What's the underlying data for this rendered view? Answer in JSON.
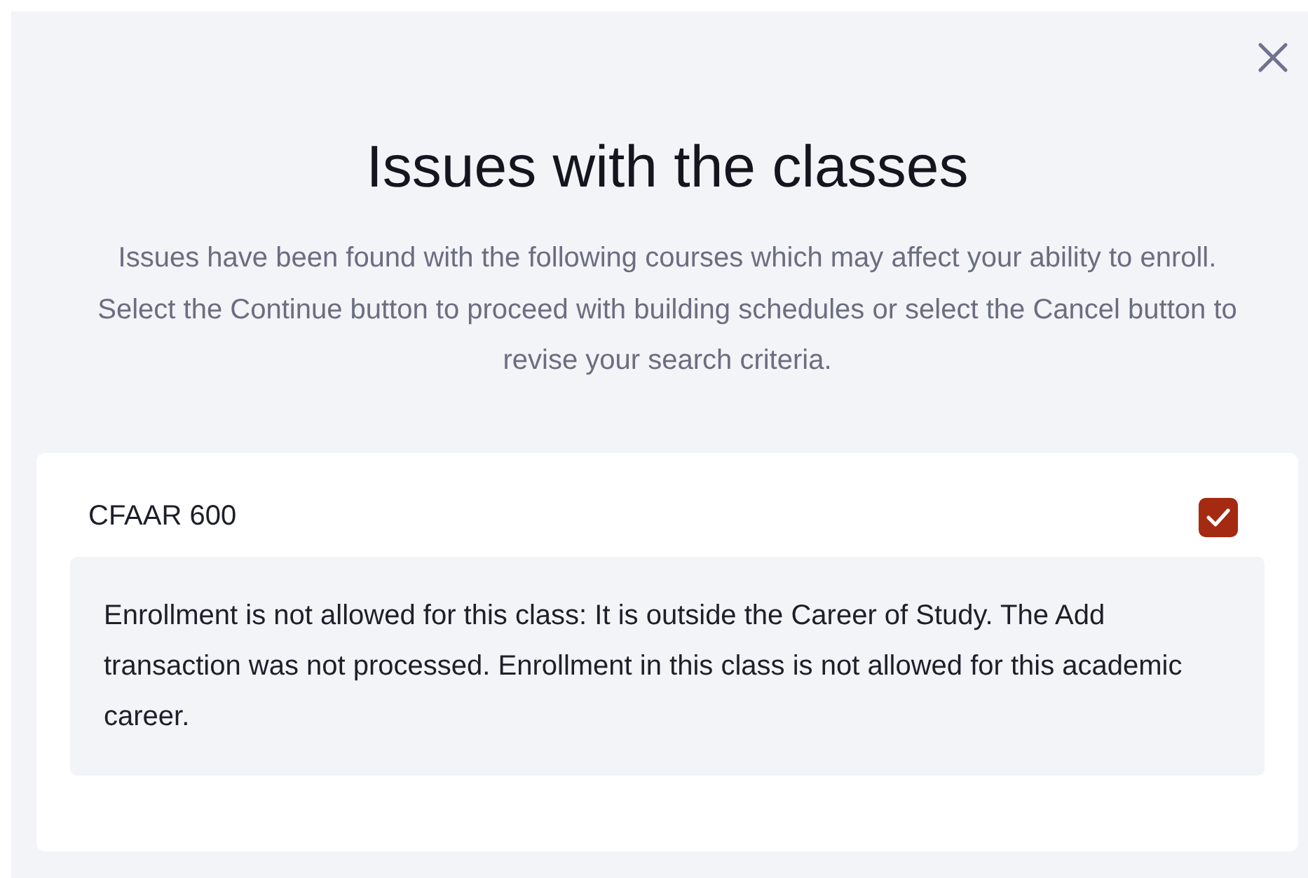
{
  "dialog": {
    "title": "Issues with the classes",
    "description": "Issues have been found with the following courses which may affect your ability to enroll. Select the Continue button to proceed with building schedules or select the Cancel button to revise your search criteria.",
    "courses": [
      {
        "name": "CFAAR 600",
        "checked": true,
        "message": "Enrollment is not allowed for this class: It is outside the Career of Study. The Add transaction was not processed. Enrollment in this class is not allowed for this academic career."
      }
    ]
  }
}
